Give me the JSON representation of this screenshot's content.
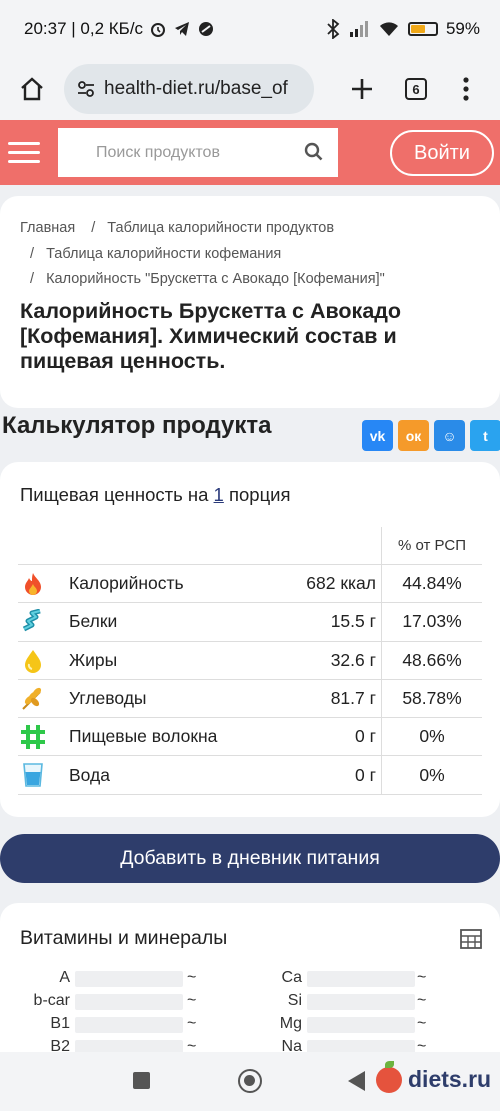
{
  "status_bar": {
    "time_speed": "20:37 | 0,2 КБ/с",
    "battery_pct": "59%",
    "battery_level": 0.59
  },
  "browser": {
    "url": "health-diet.ru/base_of",
    "tab_count": "6"
  },
  "site_header": {
    "search_placeholder": "Поиск продуктов",
    "login_label": "Войти"
  },
  "breadcrumbs": [
    "Главная",
    "Таблица калорийности продуктов",
    "Таблица калорийности кофемания",
    "Калорийность \"Брускетта с Авокадо [Кофемания]\""
  ],
  "page_title": "Калорийность Брускетта с Авокадо [Кофемания]. Химический состав и пищевая ценность.",
  "calculator": {
    "title": "Калькулятор продукта",
    "share_buttons": [
      {
        "icon": "vk-icon",
        "label": "vk",
        "color": "#2787f5"
      },
      {
        "icon": "odnoklassniki-icon",
        "label": "ок",
        "color": "#f59a2a"
      },
      {
        "icon": "moimir-icon",
        "label": "☺",
        "color": "#2a8be8"
      },
      {
        "icon": "twitter-icon",
        "label": "t",
        "color": "#2aa3ef"
      }
    ]
  },
  "nutrition": {
    "title_prefix": "Пищевая ценность на",
    "portion_count": "1",
    "title_suffix": "порция",
    "pct_header": "% от РСП",
    "rows": [
      {
        "icon": "flame-icon",
        "name": "Калорийность",
        "amount": "682 ккал",
        "pct": "44.84%"
      },
      {
        "icon": "protein-icon",
        "name": "Белки",
        "amount": "15.5 г",
        "pct": "17.03%"
      },
      {
        "icon": "fat-drop-icon",
        "name": "Жиры",
        "amount": "32.6 г",
        "pct": "48.66%"
      },
      {
        "icon": "wheat-icon",
        "name": "Углеводы",
        "amount": "81.7 г",
        "pct": "58.78%"
      },
      {
        "icon": "fiber-icon",
        "name": "Пищевые волокна",
        "amount": "0 г",
        "pct": "0%"
      },
      {
        "icon": "water-glass-icon",
        "name": "Вода",
        "amount": "0 г",
        "pct": "0%"
      }
    ]
  },
  "add_button_label": "Добавить в дневник питания",
  "vitamins": {
    "title": "Витамины и минералы",
    "left": [
      {
        "label": "A",
        "value": "~"
      },
      {
        "label": "b-car",
        "value": "~"
      },
      {
        "label": "B1",
        "value": "~"
      },
      {
        "label": "B2",
        "value": "~"
      }
    ],
    "right": [
      {
        "label": "Ca",
        "value": "~"
      },
      {
        "label": "Si",
        "value": "~"
      },
      {
        "label": "Mg",
        "value": "~"
      },
      {
        "label": "Na",
        "value": "~"
      }
    ]
  },
  "watermark": "diets.ru"
}
